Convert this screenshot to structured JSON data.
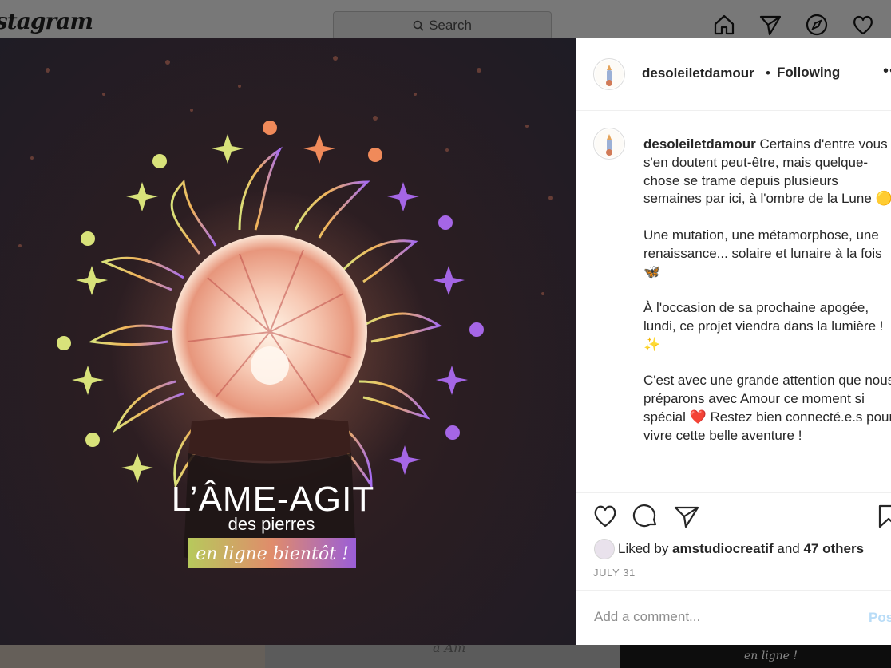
{
  "background": {
    "logo": "stagram",
    "search_placeholder": "Search",
    "nav_icons": [
      "home-icon",
      "direct-icon",
      "explore-icon",
      "activity-icon"
    ],
    "tile_text_right": "en ligne !",
    "tile_text_middle": "a Am"
  },
  "post": {
    "image": {
      "title": "L’ÂME-AGIT",
      "subtitle": "des pierres",
      "banner": "en ligne bientôt !"
    },
    "header": {
      "username": "desoleiletdamour",
      "separator": "•",
      "follow_status": "Following",
      "more": "•••"
    },
    "caption": {
      "username": "desoleiletdamour",
      "text": " Certains d'entre vous s'en doutent peut-être, mais quelque-chose se trame depuis plusieurs semaines par ici, à l'ombre de la Lune 🟡\n\nUne mutation, une métamorphose, une renaissance... solaire et lunaire à la fois 🦋\n\nÀ l'occasion de sa prochaine apogée, lundi, ce projet viendra dans la lumière ! ✨\n\nC'est avec une grande attention que nous préparons avec Amour ce moment si spécial ❤️ Restez bien connecté.e.s pour vivre cette belle aventure !"
    },
    "actions": [
      "like-icon",
      "comment-icon",
      "share-icon",
      "save-icon"
    ],
    "likes": {
      "prefix": "Liked by ",
      "user": "amstudiocreatif",
      "middle": " and ",
      "others": "47 others"
    },
    "date": "JULY 31",
    "comment": {
      "placeholder": "Add a comment...",
      "post_label": "Post"
    }
  }
}
